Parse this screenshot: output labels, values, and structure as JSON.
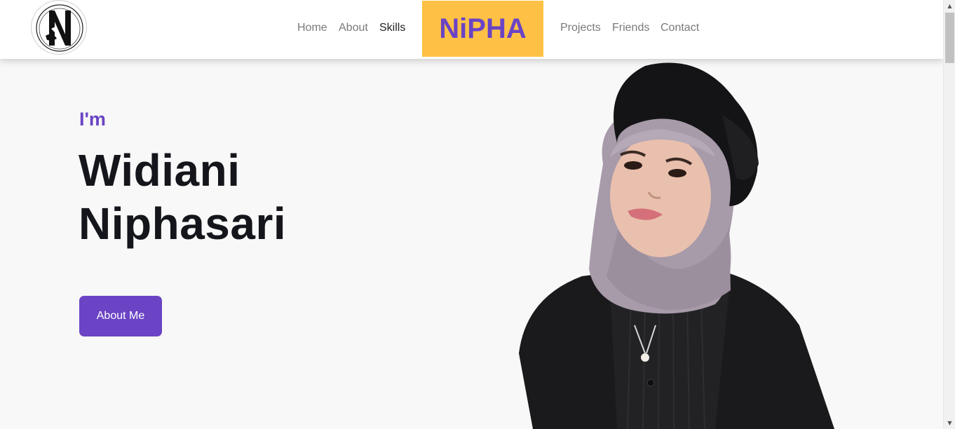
{
  "nav": {
    "left_links": [
      "Home",
      "About",
      "Skills"
    ],
    "brand": "NiPHA",
    "right_links": [
      "Projects",
      "Friends",
      "Contact"
    ],
    "active": "Skills"
  },
  "hero": {
    "intro": "I'm",
    "name_line1": "Widiani",
    "name_line2": "Niphasari",
    "button_label": "About Me"
  },
  "colors": {
    "accent": "#6a44c4",
    "brand_bg": "#ffc145",
    "heading": "#14161b",
    "background": "#f8f8f8"
  },
  "icons": {
    "logo": "N-monogram-logo",
    "scroll_up": "triangle-up-icon",
    "scroll_down": "triangle-down-icon"
  }
}
